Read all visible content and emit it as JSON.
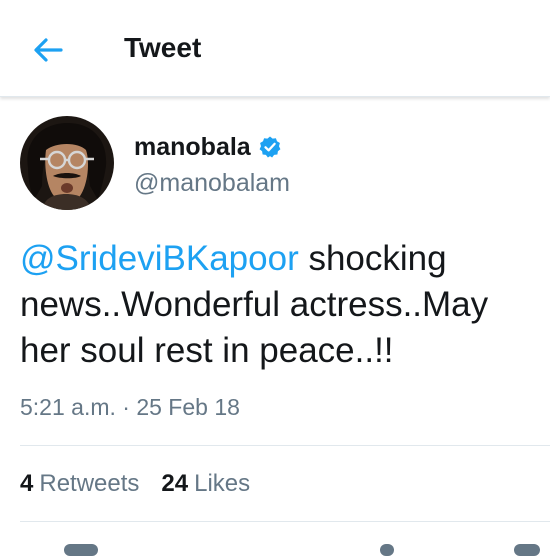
{
  "header": {
    "title": "Tweet",
    "back_icon": "arrow-left-icon",
    "back_color": "#1da1f2"
  },
  "tweet": {
    "author": {
      "display_name": "manobala",
      "handle": "@manobalam",
      "verified_icon": "verified-badge-icon",
      "verified_color": "#1da1f2"
    },
    "text": {
      "mention": "@SrideviBKapoor",
      "body": " shocking news..Wonderful  actress..May her soul rest in peace..!!"
    },
    "timestamp": "5:21 a.m. · 25 Feb 18"
  },
  "stats": {
    "retweets_count": "4",
    "retweets_label": "Retweets",
    "likes_count": "24",
    "likes_label": "Likes"
  },
  "colors": {
    "accent": "#1da1f2",
    "secondary_text": "#657786",
    "divider": "#e1e8ed"
  }
}
